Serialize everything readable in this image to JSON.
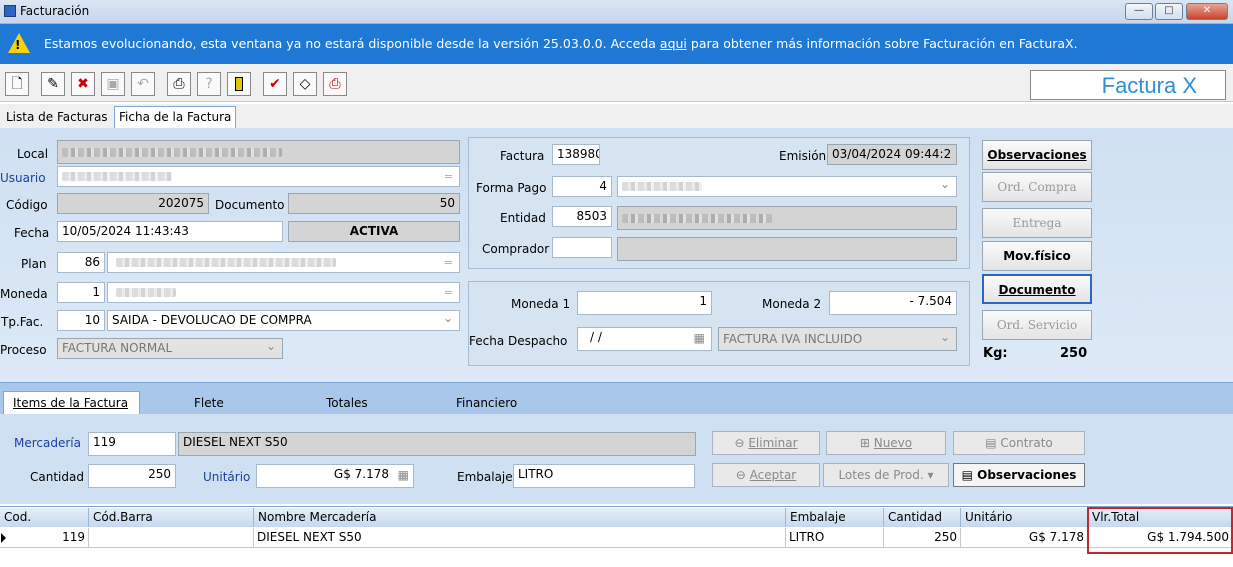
{
  "window": {
    "title": "Facturación"
  },
  "banner": {
    "text_before": "Estamos evolucionando, esta ventana ya no estará disponible desde la versión 25.03.0.0. Acceda ",
    "link": "aqui",
    "text_after": " para obtener más información sobre Facturación en FacturaX."
  },
  "brand": "Factura X",
  "top_tabs": [
    "Lista de Facturas",
    "Ficha de la Factura"
  ],
  "left": {
    "local_label": "Local",
    "usuario_label": "Usuario",
    "codigo_label": "Código",
    "codigo_value": "202075",
    "documento_label": "Documento",
    "documento_value": "50",
    "fecha_label": "Fecha",
    "fecha_value": "10/05/2024 11:43:43",
    "status": "ACTIVA",
    "plan_label": "Plan",
    "plan_value": "86",
    "moneda_label": "Moneda",
    "moneda_value": "1",
    "tpfac_label": "Tp.Fac.",
    "tpfac_code": "10",
    "tpfac_value": "SAIDA - DEVOLUCAO DE COMPRA",
    "proceso_label": "Proceso",
    "proceso_value": "FACTURA NORMAL"
  },
  "middle": {
    "factura_label": "Factura",
    "factura_value": "138980",
    "emision_label": "Emisión",
    "emision_value": "03/04/2024 09:44:2",
    "formapago_label": "Forma Pago",
    "formapago_value": "4",
    "entidad_label": "Entidad",
    "entidad_value": "8503",
    "comprador_label": "Comprador",
    "moneda1_label": "Moneda 1",
    "moneda1_value": "1",
    "moneda2_label": "Moneda 2",
    "moneda2_value": "- 7.504",
    "despacho_label": "Fecha Despacho",
    "despacho_value": "/ /",
    "iva_value": "FACTURA IVA INCLUIDO"
  },
  "side_buttons": [
    "Observaciones",
    "Ord. Compra",
    "Entrega",
    "Mov.físico",
    "Documento",
    "Ord. Servicio"
  ],
  "kg_label": "Kg:",
  "kg_value": "250",
  "lower_tabs": [
    "Items de la Factura",
    "Flete",
    "Totales",
    "Financiero"
  ],
  "item": {
    "mercaderia_label": "Mercadería",
    "mercaderia_code": "119",
    "mercaderia_name": "DIESEL NEXT S50",
    "cantidad_label": "Cantidad",
    "cantidad_value": "250",
    "unitario_label": "Unitário",
    "unitario_value": "G$ 7.178",
    "embalaje_label": "Embalaje",
    "embalaje_value": "LITRO",
    "eliminar": "Eliminar",
    "nuevo": "Nuevo",
    "contrato": "Contrato",
    "aceptar": "Aceptar",
    "lotes": "Lotes de Prod.",
    "observaciones": "Observaciones"
  },
  "grid": {
    "headers": [
      "Cod.",
      "Cód.Barra",
      "Nombre Mercadería",
      "Embalaje",
      "Cantidad",
      "Unitário",
      "Vlr.Total"
    ],
    "row": [
      "119",
      "",
      "DIESEL NEXT S50",
      "LITRO",
      "250",
      "G$ 7.178",
      "G$ 1.794.500"
    ]
  }
}
